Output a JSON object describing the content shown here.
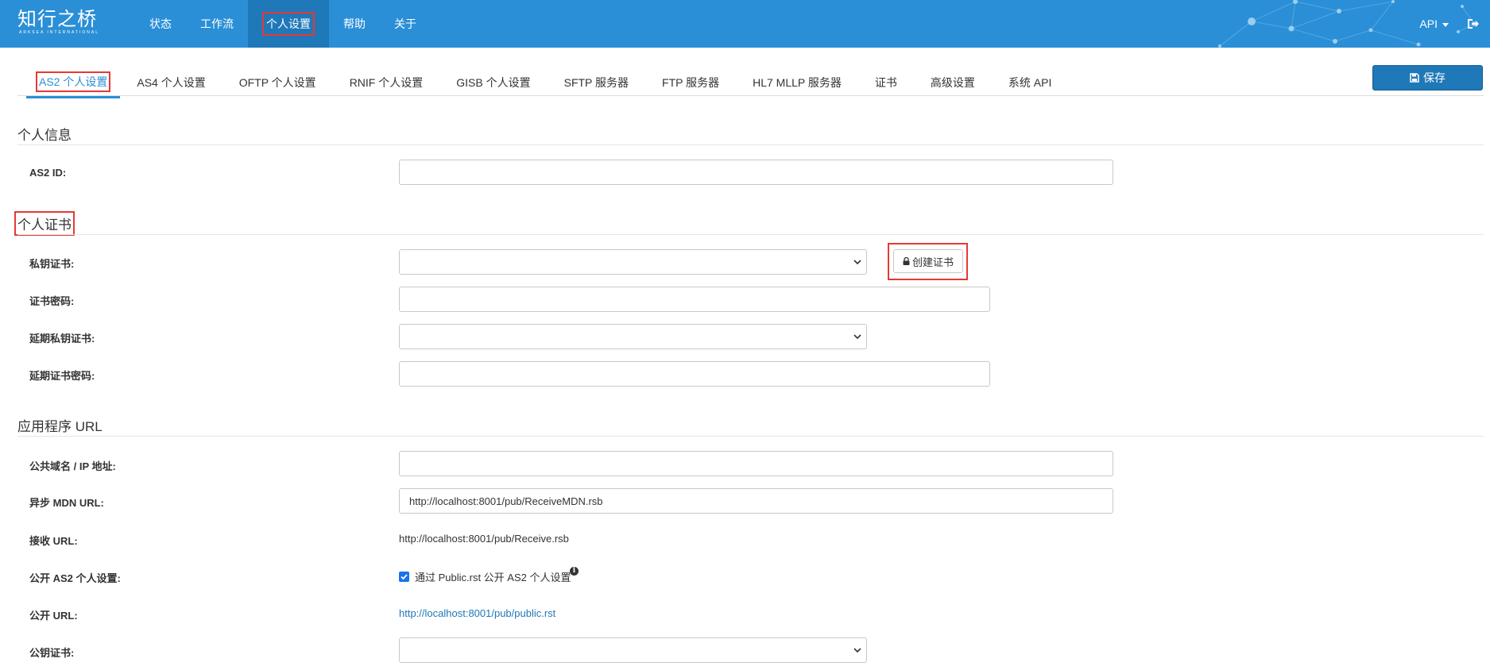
{
  "app": {
    "logo_text": "知行之桥",
    "logo_subtext": "ARKSEA INTERNATIONAL"
  },
  "nav": {
    "items": [
      {
        "label": "状态"
      },
      {
        "label": "工作流"
      },
      {
        "label": "个人设置"
      },
      {
        "label": "帮助"
      },
      {
        "label": "关于"
      }
    ],
    "active": "个人设置",
    "api_label": "API",
    "logout_icon": "sign-out-icon"
  },
  "tabs": {
    "items": [
      {
        "label": "AS2 个人设置"
      },
      {
        "label": "AS4 个人设置"
      },
      {
        "label": "OFTP 个人设置"
      },
      {
        "label": "RNIF 个人设置"
      },
      {
        "label": "GISB 个人设置"
      },
      {
        "label": "SFTP 服务器"
      },
      {
        "label": "FTP 服务器"
      },
      {
        "label": "HL7 MLLP 服务器"
      },
      {
        "label": "证书"
      },
      {
        "label": "高级设置"
      },
      {
        "label": "系统 API"
      }
    ],
    "active": "AS2 个人设置",
    "save_label": "保存",
    "save_icon": "save-icon"
  },
  "personal_info": {
    "title": "个人信息",
    "as2_id_label": "AS2 ID:",
    "as2_id_value": ""
  },
  "personal_cert": {
    "title": "个人证书",
    "private_cert_label": "私钥证书:",
    "private_cert_value": "",
    "create_cert_label": "创建证书",
    "create_cert_icon": "lock-icon",
    "cert_password_label": "证书密码:",
    "cert_password_value": "",
    "deferred_private_cert_label": "延期私钥证书:",
    "deferred_private_cert_value": "",
    "deferred_cert_password_label": "延期证书密码:",
    "deferred_cert_password_value": ""
  },
  "app_url": {
    "title": "应用程序 URL",
    "public_domain_label": "公共域名 / IP 地址:",
    "public_domain_value": "",
    "async_mdn_label": "异步 MDN URL:",
    "async_mdn_value": "http://localhost:8001/pub/ReceiveMDN.rsb",
    "receive_url_label": "接收 URL:",
    "receive_url_value": "http://localhost:8001/pub/Receive.rsb",
    "public_as2_label": "公开 AS2 个人设置:",
    "public_as2_checked": true,
    "public_as2_check_label": "通过 Public.rst 公开 AS2 个人设置",
    "public_as2_info_icon": "info-icon",
    "public_url_label": "公开 URL:",
    "public_url_value": "http://localhost:8001/pub/public.rst",
    "public_cert_label": "公钥证书:",
    "public_cert_value": ""
  },
  "colors": {
    "topbar": "#2a8fd6",
    "active_nav": "#1f78b8",
    "accent": "#2a8fd6",
    "highlight": "#e53935"
  }
}
